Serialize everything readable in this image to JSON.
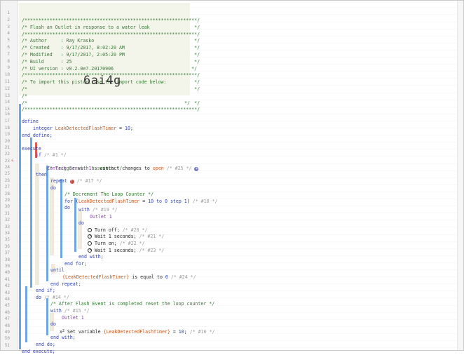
{
  "header": {
    "border": "/**************************************************************/",
    "title": "/* Flash an Outlet in response to a water leak                */",
    "author": "/* Author     : Ray Krasko                                    */",
    "created": "/* Created    : 9/17/2017, 8:02:20 AM                         */",
    "modified": "/* Modified   : 9/17/2017, 2:05:20 PM                         */",
    "build": "/* Build      : 25                                            */",
    "ui_version": "/* UI version : v0.2.0e7.20170906                            */",
    "import_note": "/* To import this piston, use the import code below:          */",
    "blank": "/*                                                            */",
    "import_prefix": "/*",
    "import_suffix": "*/",
    "import_code": "6ai4g"
  },
  "line_numbers": [
    "1",
    "2",
    "3",
    "4",
    "5",
    "6",
    "7",
    "8",
    "9",
    "10",
    "11",
    "12",
    "13",
    "14",
    "15",
    "16",
    "17",
    "18",
    "19",
    "20",
    "21",
    "22",
    "23",
    "24",
    "25",
    "26",
    "27",
    "28",
    "29",
    "30",
    "31",
    "32",
    "33",
    "34",
    "35",
    "36",
    "37",
    "38",
    "39",
    "40",
    "41",
    "42",
    "43",
    "44",
    "45",
    "46",
    "47",
    "48",
    "49",
    "50",
    "51"
  ],
  "code": {
    "define": "define",
    "var_type": "integer",
    "var_name": "LeakDetectedFlashTimer",
    "assign": " = ",
    "var_value": "10",
    "semicolon": ";",
    "end_define": "end define;",
    "execute": "execute",
    "if": "if",
    "if_id": "/* #1 */",
    "trigger_comment": "/* Trigger with a switch */",
    "contact_device": "Contact Sensor 1",
    "contact_text": "'s contact changes to ",
    "contact_value": "open",
    "contact_id": "/* #25 */",
    "then": "then",
    "repeat": "repeat",
    "repeat_badge": "!",
    "repeat_id": "/* #17 */",
    "do": "do",
    "decrement_comment": "/* Decrement The Loop Counter */",
    "for_kw": "for",
    "for_open": " (",
    "for_var": "LeakDetectedFlashTimer",
    "for_eq": " = ",
    "for_start": "10",
    "for_to": " to ",
    "for_end": "0",
    "for_step": " step ",
    "for_step_val": "1",
    "for_close": ")",
    "for_id": "/* #18 */",
    "with": "with",
    "with_id_1": "/* #19 */",
    "outlet": "Outlet 1",
    "turn_off": "Turn off;",
    "turn_off_id": "/* #20 */",
    "wait": "Wait 1 seconds;",
    "wait_id_1": "/* #21 */",
    "turn_on": "Turn on;",
    "turn_on_id": "/* #22 */",
    "wait_id_2": "/* #23 */",
    "end_with": "end with;",
    "end_for": "end for;",
    "until": "until",
    "until_var": "{LeakDetectedFlashTimer}",
    "until_text": " is equal to ",
    "until_value": "0",
    "until_id": "/* #24 */",
    "end_repeat": "end repeat;",
    "end_if": "end if;",
    "do_id": "/* #14 */",
    "reset_comment": "/* After Flash Event is completed reset the loop counter */",
    "with_id_2": "/* #15 */",
    "set_icon": "x",
    "set_icon_sup": "2",
    "set_variable": "Set variable ",
    "set_var": "{LeakDetectedFlashTimer}",
    "set_id": "/* #16 */",
    "end_do": "end do;",
    "end_execute": "end execute;"
  }
}
